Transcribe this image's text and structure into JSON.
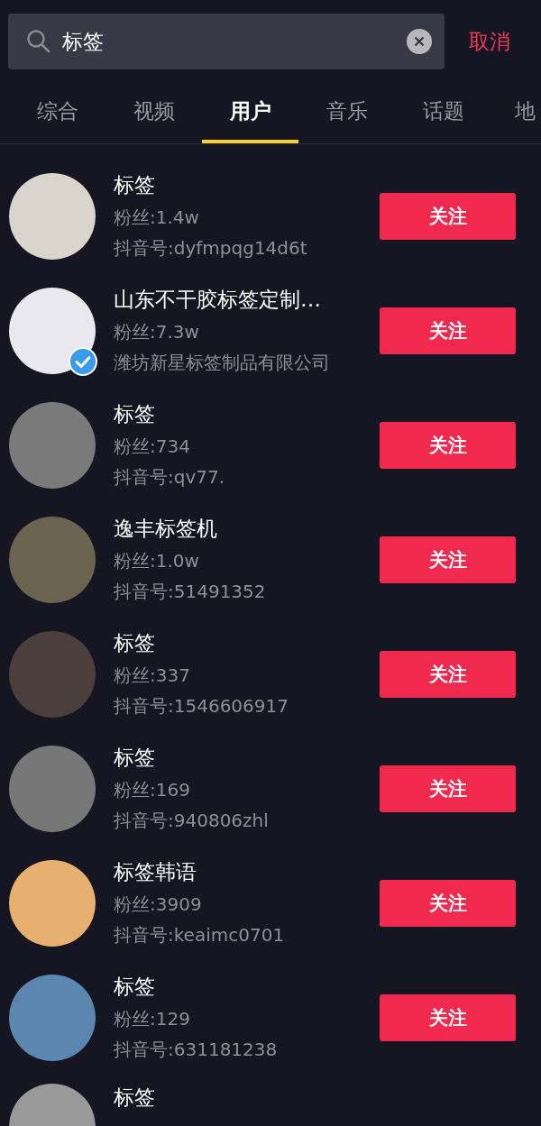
{
  "search": {
    "value": "标签",
    "cancel": "取消"
  },
  "tabs": [
    {
      "label": "综合",
      "selected": false
    },
    {
      "label": "视频",
      "selected": false
    },
    {
      "label": "用户",
      "selected": true
    },
    {
      "label": "音乐",
      "selected": false
    },
    {
      "label": "话题",
      "selected": false
    },
    {
      "label": "地",
      "selected": false
    }
  ],
  "users": [
    {
      "name": "标签",
      "fans": "粉丝:1.4w",
      "detail": "抖音号:dyfmpqg14d6t",
      "verified": false,
      "follow": "关注"
    },
    {
      "name": "山东不干胶标签定制…",
      "fans": "粉丝:7.3w",
      "detail": "潍坊新星标签制品有限公司",
      "verified": true,
      "follow": "关注"
    },
    {
      "name": "标签",
      "fans": "粉丝:734",
      "detail": "抖音号:qv77.",
      "verified": false,
      "follow": "关注"
    },
    {
      "name": "逸丰标签机",
      "fans": "粉丝:1.0w",
      "detail": "抖音号:51491352",
      "verified": false,
      "follow": "关注"
    },
    {
      "name": "标签",
      "fans": "粉丝:337",
      "detail": "抖音号:1546606917",
      "verified": false,
      "follow": "关注"
    },
    {
      "name": "标签",
      "fans": "粉丝:169",
      "detail": "抖音号:940806zhl",
      "verified": false,
      "follow": "关注"
    },
    {
      "name": "标签韩语",
      "fans": "粉丝:3909",
      "detail": "抖音号:keaimc0701",
      "verified": false,
      "follow": "关注"
    },
    {
      "name": "标签",
      "fans": "粉丝:129",
      "detail": "抖音号:631181238",
      "verified": false,
      "follow": "关注"
    },
    {
      "name": "标签",
      "verified": false
    }
  ]
}
